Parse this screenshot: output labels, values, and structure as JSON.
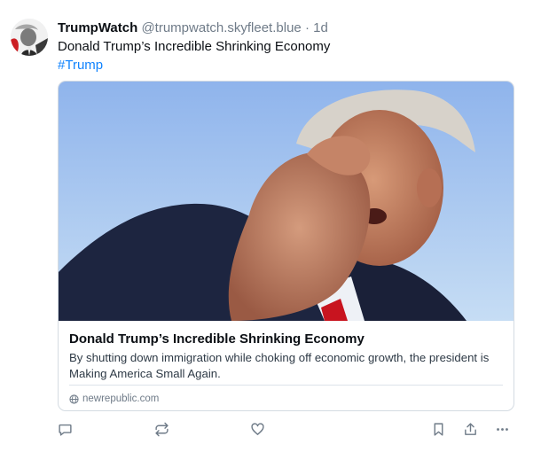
{
  "post": {
    "author": {
      "display_name": "TrumpWatch",
      "handle": "@trumpwatch.skyfleet.blue",
      "separator": "·",
      "time": "1d"
    },
    "text": "Donald Trump’s Incredible Shrinking Economy",
    "hashtag": "#Trump",
    "embed": {
      "title": "Donald Trump’s Incredible Shrinking Economy",
      "description": "By shutting down immigration while choking off economic growth, the president is Making America Small Again.",
      "source": "newrepublic.com"
    },
    "actions": [
      "reply-icon",
      "repost-icon",
      "like-icon",
      "bookmark-icon",
      "share-icon",
      "more-icon"
    ]
  },
  "colors": {
    "hashtag": "#1083fe",
    "muted": "#6f7b88",
    "border": "#d4dbe2",
    "icon": "#6f7b88"
  }
}
